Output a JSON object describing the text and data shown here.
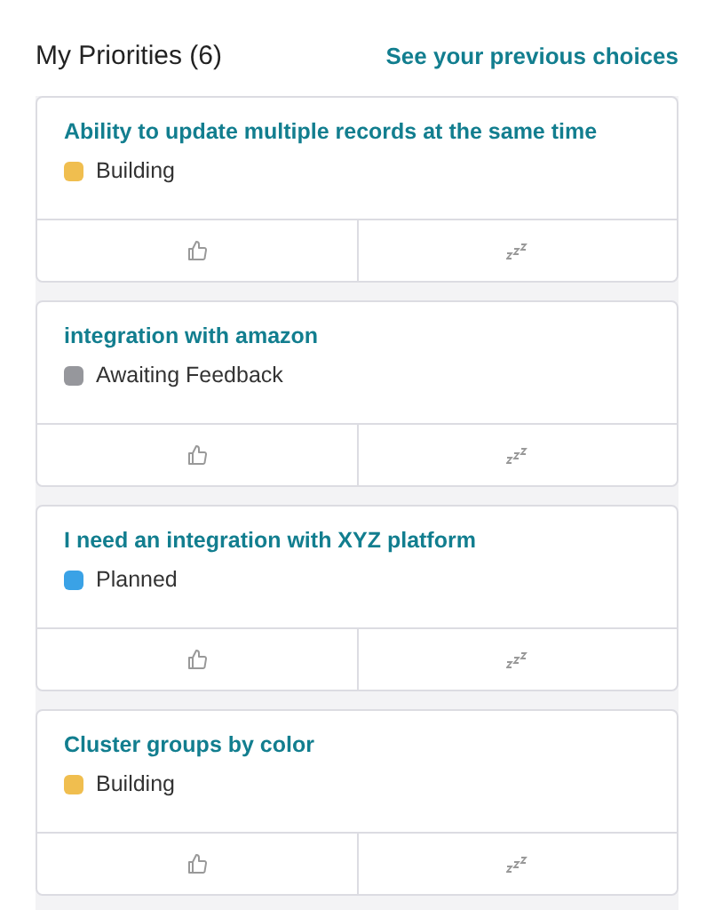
{
  "header": {
    "title": "My Priorities (6)",
    "link": "See your previous choices"
  },
  "cards": [
    {
      "title": "Ability to update multiple records at the same time",
      "status": "Building",
      "color": "#f0be4f"
    },
    {
      "title": "integration with amazon",
      "status": "Awaiting Feedback",
      "color": "#96979c"
    },
    {
      "title": "I need an integration with XYZ platform",
      "status": "Planned",
      "color": "#3aa2e6"
    },
    {
      "title": "Cluster groups by color",
      "status": "Building",
      "color": "#f0be4f"
    }
  ]
}
